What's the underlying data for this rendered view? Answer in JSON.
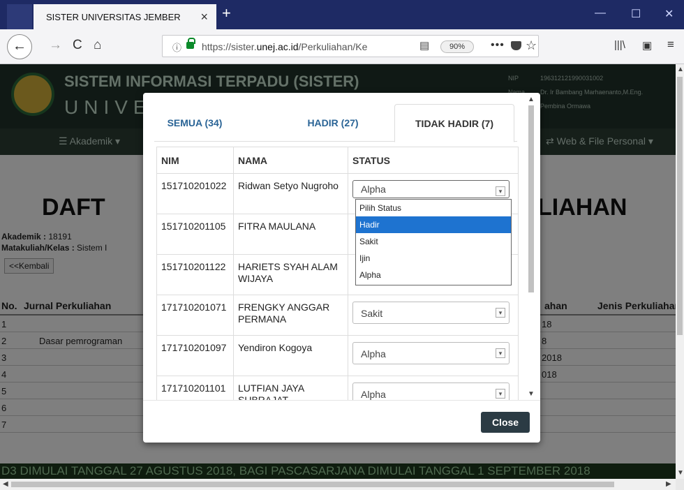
{
  "browser": {
    "tab_title": "SISTER UNIVERSITAS JEMBER",
    "tab_close": "×",
    "new_tab": "+",
    "minimize": "—",
    "maximize": "☐",
    "close": "✕",
    "url_prefix": "https://sister.",
    "url_domain": "unej.ac.id",
    "url_rest": "/Perkuliahan/Ke",
    "zoom": "90%"
  },
  "site": {
    "title": "SISTEM INFORMASI TERPADU (SISTER)",
    "subtitle": "UNIVE",
    "nip_label": "NIP",
    "nip_value": "196312121990031002",
    "name_label": "Nama",
    "name_value": "Dr. Ir Bambang Marhaenanto,M.Eng.",
    "role_value": "Pembina Ormawa",
    "menu_akademik": "Akademik",
    "menu_web": "Web & File Personal",
    "page_title_left": "DAFT",
    "page_title_right": "LIAHAN",
    "akademik_label": "Akademik :",
    "akademik_value": "18191",
    "matakuliah_label": "Matakuliah/Kelas :",
    "matakuliah_value": "Sistem I",
    "back_button": "<<Kembali",
    "col_no": "No.",
    "col_jurnal": "Jurnal Perkuliahan",
    "col_ahan": "ahan",
    "col_jenis": "Jenis Perkuliahan",
    "rows": [
      {
        "no": "1",
        "jurnal": "",
        "tgl": "18"
      },
      {
        "no": "2",
        "jurnal": "Dasar pemrograman",
        "tgl": "8"
      },
      {
        "no": "3",
        "jurnal": "",
        "tgl": "2018"
      },
      {
        "no": "4",
        "jurnal": "",
        "tgl": "018"
      },
      {
        "no": "5",
        "jurnal": "",
        "tgl": ""
      },
      {
        "no": "6",
        "jurnal": "",
        "tgl": ""
      },
      {
        "no": "7",
        "jurnal": "",
        "tgl": ""
      }
    ],
    "ticker": "D3 DIMULAI TANGGAL 27 AGUSTUS 2018, BAGI PASCASARJANA DIMULAI TANGGAL 1 SEPTEMBER 2018"
  },
  "modal": {
    "tabs": [
      {
        "label": "SEMUA (34)"
      },
      {
        "label": "HADIR (27)"
      },
      {
        "label": "TIDAK HADIR (7)"
      }
    ],
    "headers": {
      "nim": "NIM",
      "nama": "NAMA",
      "status": "STATUS"
    },
    "students": [
      {
        "nim": "151710201022",
        "nama": "Ridwan Setyo Nugroho",
        "status": "Alpha"
      },
      {
        "nim": "151710201105",
        "nama": "FITRA MAULANA",
        "status": ""
      },
      {
        "nim": "151710201122",
        "nama": "HARIETS SYAH ALAM WIJAYA",
        "status": ""
      },
      {
        "nim": "171710201071",
        "nama": "FRENGKY ANGGAR PERMANA",
        "status": "Sakit"
      },
      {
        "nim": "171710201097",
        "nama": "Yendiron Kogoya",
        "status": "Alpha"
      },
      {
        "nim": "171710201101",
        "nama": "LUTFIAN JAYA SUBRAJAT",
        "status": "Alpha"
      }
    ],
    "dropdown_options": [
      "Pilih Status",
      "Hadir",
      "Sakit",
      "Ijin",
      "Alpha"
    ],
    "highlighted_option": "Hadir",
    "close_button": "Close"
  }
}
